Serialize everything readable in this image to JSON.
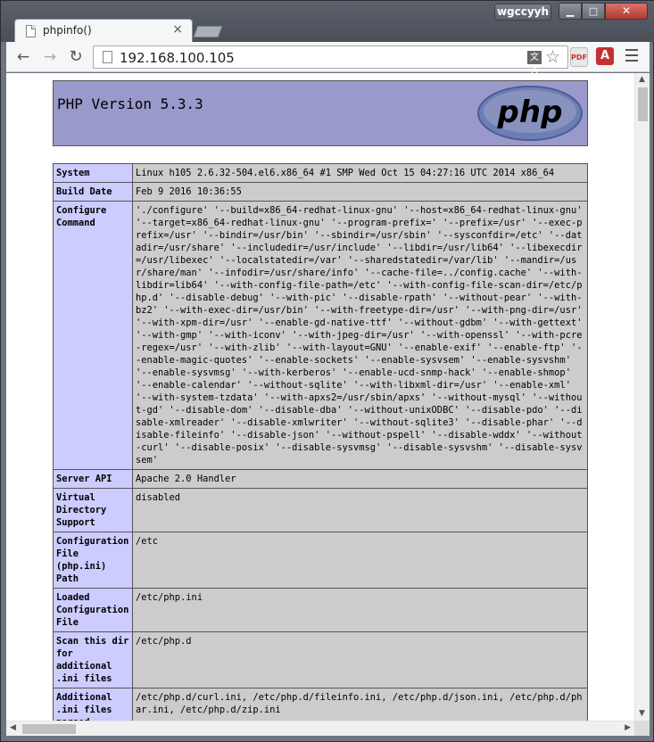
{
  "window": {
    "user_badge": "wgccyyh",
    "min_glyph": "▁",
    "max_glyph": "□",
    "close_glyph": "✕"
  },
  "tab": {
    "title": "phpinfo()",
    "close_glyph": "×"
  },
  "toolbar": {
    "url": "192.168.100.105",
    "back_glyph": "←",
    "forward_glyph": "→",
    "reload_glyph": "↻",
    "star_glyph": "☆",
    "ext1_label": "PDF",
    "ext2_label": "A"
  },
  "colors": {
    "header_bg": "#9999cc",
    "key_bg": "#ccccff",
    "value_bg": "#cccccc"
  },
  "php": {
    "version_title": "PHP Version 5.3.3",
    "logo_text": "php"
  },
  "rows": [
    {
      "key": "System",
      "value": "Linux h105 2.6.32-504.el6.x86_64 #1 SMP Wed Oct 15 04:27:16 UTC 2014 x86_64"
    },
    {
      "key": "Build Date",
      "value": "Feb 9 2016 10:36:55"
    },
    {
      "key": "Configure Command",
      "value": "'./configure' '--build=x86_64-redhat-linux-gnu' '--host=x86_64-redhat-linux-gnu' '--target=x86_64-redhat-linux-gnu' '--program-prefix=' '--prefix=/usr' '--exec-prefix=/usr' '--bindir=/usr/bin' '--sbindir=/usr/sbin' '--sysconfdir=/etc' '--datadir=/usr/share' '--includedir=/usr/include' '--libdir=/usr/lib64' '--libexecdir=/usr/libexec' '--localstatedir=/var' '--sharedstatedir=/var/lib' '--mandir=/usr/share/man' '--infodir=/usr/share/info' '--cache-file=../config.cache' '--with-libdir=lib64' '--with-config-file-path=/etc' '--with-config-file-scan-dir=/etc/php.d' '--disable-debug' '--with-pic' '--disable-rpath' '--without-pear' '--with-bz2' '--with-exec-dir=/usr/bin' '--with-freetype-dir=/usr' '--with-png-dir=/usr' '--with-xpm-dir=/usr' '--enable-gd-native-ttf' '--without-gdbm' '--with-gettext' '--with-gmp' '--with-iconv' '--with-jpeg-dir=/usr' '--with-openssl' '--with-pcre-regex=/usr' '--with-zlib' '--with-layout=GNU' '--enable-exif' '--enable-ftp' '--enable-magic-quotes' '--enable-sockets' '--enable-sysvsem' '--enable-sysvshm' '--enable-sysvmsg' '--with-kerberos' '--enable-ucd-snmp-hack' '--enable-shmop' '--enable-calendar' '--without-sqlite' '--with-libxml-dir=/usr' '--enable-xml' '--with-system-tzdata' '--with-apxs2=/usr/sbin/apxs' '--without-mysql' '--without-gd' '--disable-dom' '--disable-dba' '--without-unixODBC' '--disable-pdo' '--disable-xmlreader' '--disable-xmlwriter' '--without-sqlite3' '--disable-phar' '--disable-fileinfo' '--disable-json' '--without-pspell' '--disable-wddx' '--without-curl' '--disable-posix' '--disable-sysvmsg' '--disable-sysvshm' '--disable-sysvsem'"
    },
    {
      "key": "Server API",
      "value": "Apache 2.0 Handler"
    },
    {
      "key": "Virtual Directory Support",
      "value": "disabled"
    },
    {
      "key": "Configuration File (php.ini) Path",
      "value": "/etc"
    },
    {
      "key": "Loaded Configuration File",
      "value": "/etc/php.ini"
    },
    {
      "key": "Scan this dir for additional .ini files",
      "value": "/etc/php.d"
    },
    {
      "key": "Additional .ini files parsed",
      "value": "/etc/php.d/curl.ini, /etc/php.d/fileinfo.ini, /etc/php.d/json.ini, /etc/php.d/phar.ini, /etc/php.d/zip.ini"
    }
  ]
}
